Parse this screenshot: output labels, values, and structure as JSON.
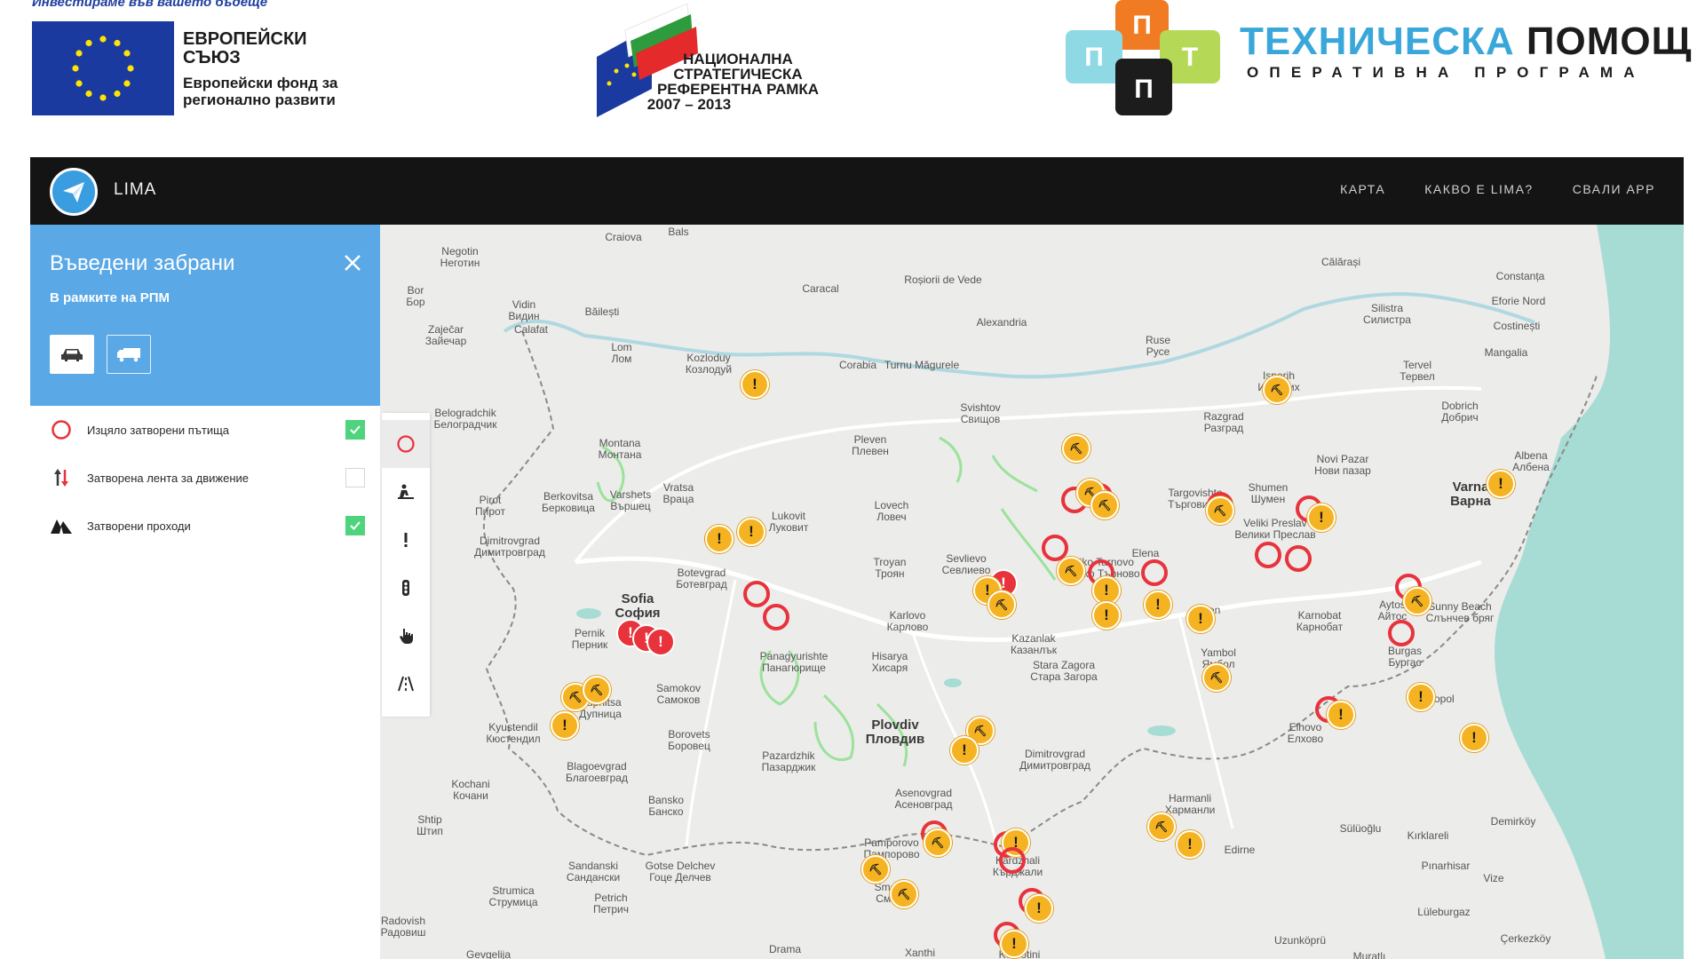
{
  "banner": {
    "eu_tagline": "Инвестираме във вашето бъдеще",
    "eu_title": "ЕВРОПЕЙСКИ СЪЮЗ",
    "eu_fund": "Европейски фонд за регионално развити",
    "nsrf_text": "НАЦИОНАЛНА СТРАТЕГИЧЕСКА РЕФЕРЕНТНА РАМКА",
    "nsrf_years": "2007 – 2013",
    "ta_title_blue": "ТЕХНИЧЕСКА",
    "ta_title_dark": "ПОМОЩ",
    "ta_subtitle": "ОПЕРАТИВНА ПРОГРАМА",
    "ta_letters": [
      "П",
      "П",
      "Т",
      "П"
    ],
    "colors": {
      "eu_blue": "#1a3aa0",
      "ta_blue": "#3aa7da"
    }
  },
  "navbar": {
    "app_name": "LIMA",
    "logo_icon": "paper-plane-icon",
    "links": [
      "КАРТА",
      "КАКВО Е LIMA?",
      "СВАЛИ APP"
    ]
  },
  "panel": {
    "title": "Въведени забрани",
    "subtitle": "В рамките на РПМ",
    "close_icon": "close-icon",
    "vehicle_types": [
      {
        "icon": "car-icon",
        "active": true
      },
      {
        "icon": "truck-icon",
        "active": false
      }
    ],
    "filters": [
      {
        "label": "Изцяло затворени пътища",
        "icon": "closed-road-icon",
        "checked": true
      },
      {
        "label": "Затворена лента за движение",
        "icon": "closed-lane-icon",
        "checked": false
      },
      {
        "label": "Затворени проходи",
        "icon": "mountain-pass-icon",
        "checked": true
      }
    ],
    "accent_color": "#5aa8e6",
    "check_color": "#4fd37d"
  },
  "toolbar": {
    "tools": [
      {
        "icon": "closed-road-icon",
        "active": true
      },
      {
        "icon": "road-works-icon",
        "active": false
      },
      {
        "icon": "warning-icon",
        "active": false
      },
      {
        "icon": "traffic-light-icon",
        "active": false
      },
      {
        "icon": "hand-pointer-icon",
        "active": false
      },
      {
        "icon": "road-icon",
        "active": false
      }
    ]
  },
  "map": {
    "cities_major": [
      {
        "name": "Sofia",
        "local": "София"
      },
      {
        "name": "Plovdiv",
        "local": "Пловдив"
      }
    ],
    "cities": [
      {
        "name": "Craiova",
        "local": ""
      },
      {
        "name": "Bals",
        "local": ""
      },
      {
        "name": "Negotin",
        "local": "Неготин"
      },
      {
        "name": "Bor",
        "local": "Бор"
      },
      {
        "name": "Vidin",
        "local": "Видин"
      },
      {
        "name": "Calafat",
        "local": ""
      },
      {
        "name": "Băilești",
        "local": ""
      },
      {
        "name": "Caracal",
        "local": ""
      },
      {
        "name": "Roșiorii de Vede",
        "local": ""
      },
      {
        "name": "Alexandria",
        "local": ""
      },
      {
        "name": "Călărași",
        "local": ""
      },
      {
        "name": "Constanța",
        "local": ""
      },
      {
        "name": "Eforie Nord",
        "local": ""
      },
      {
        "name": "Costinești",
        "local": ""
      },
      {
        "name": "Mangalia",
        "local": ""
      },
      {
        "name": "Zaječar",
        "local": "Зайечар"
      },
      {
        "name": "Lom",
        "local": "Лом"
      },
      {
        "name": "Kozloduy",
        "local": "Козлодуй"
      },
      {
        "name": "Corabia",
        "local": ""
      },
      {
        "name": "Turnu Măgurele",
        "local": ""
      },
      {
        "name": "Ruse",
        "local": "Русе"
      },
      {
        "name": "Silistra",
        "local": "Силистра"
      },
      {
        "name": "Tervel",
        "local": "Тервел"
      },
      {
        "name": "Dobrich",
        "local": "Добрич"
      },
      {
        "name": "Belogradchik",
        "local": "Белоградчик"
      },
      {
        "name": "Montana",
        "local": "Монтана"
      },
      {
        "name": "Pleven",
        "local": "Плевен"
      },
      {
        "name": "Svishtov",
        "local": "Свищов"
      },
      {
        "name": "Razgrad",
        "local": "Разград"
      },
      {
        "name": "Novi Pazar",
        "local": "Нови пазар"
      },
      {
        "name": "Varna",
        "local": "Варна"
      },
      {
        "name": "Pirot",
        "local": "Пирот"
      },
      {
        "name": "Berkovitsa",
        "local": "Берковица"
      },
      {
        "name": "Varshets",
        "local": "Вършец"
      },
      {
        "name": "Vratsa",
        "local": "Враца"
      },
      {
        "name": "Lukovit",
        "local": "Луковит"
      },
      {
        "name": "Lovech",
        "local": "Ловеч"
      },
      {
        "name": "Targovishte",
        "local": "Търговище"
      },
      {
        "name": "Shumen",
        "local": "Шумен"
      },
      {
        "name": "Veliki Preslav",
        "local": "Велики Преслав"
      },
      {
        "name": "Dimitrovgrad",
        "local": "Димитровград"
      },
      {
        "name": "Botevgrad",
        "local": "Ботевград"
      },
      {
        "name": "Troyan",
        "local": "Троян"
      },
      {
        "name": "Sevlievo",
        "local": "Севлиево"
      },
      {
        "name": "Veliko Tarnovo",
        "local": "Велико Търново"
      },
      {
        "name": "Elena",
        "local": ""
      },
      {
        "name": "Aytos",
        "local": "Айтос"
      },
      {
        "name": "Sunny Beach",
        "local": "Слънчев бряг"
      },
      {
        "name": "Karnobat",
        "local": "Карнобат"
      },
      {
        "name": "Pernik",
        "local": "Перник"
      },
      {
        "name": "Karlovo",
        "local": "Карлово"
      },
      {
        "name": "Kazanlak",
        "local": "Казанлък"
      },
      {
        "name": "Sliven",
        "local": ""
      },
      {
        "name": "Yambol",
        "local": "Ямбол"
      },
      {
        "name": "Burgas",
        "local": "Бургас"
      },
      {
        "name": "Panagyurishte",
        "local": "Панагюрище"
      },
      {
        "name": "Hisarya",
        "local": "Хисаря"
      },
      {
        "name": "Stara Zagora",
        "local": "Стара Загора"
      },
      {
        "name": "Samokov",
        "local": "Самоков"
      },
      {
        "name": "Borovets",
        "local": "Боровец"
      },
      {
        "name": "Dupnitsa",
        "local": "Дупница"
      },
      {
        "name": "Kyustendil",
        "local": "Кюстендил"
      },
      {
        "name": "Sozopol",
        "local": "Созопол"
      },
      {
        "name": "Elhovo",
        "local": "Елхово"
      },
      {
        "name": "Pazardzhik",
        "local": "Пазарджик"
      },
      {
        "name": "Dimitrovgrad",
        "local": "Димитровград"
      },
      {
        "name": "Blagoevgrad",
        "local": "Благоевград"
      },
      {
        "name": "Kochani",
        "local": "Кочани"
      },
      {
        "name": "Asenovgrad",
        "local": "Асеновград"
      },
      {
        "name": "Harmanli",
        "local": "Харманли"
      },
      {
        "name": "Bansko",
        "local": "Банско"
      },
      {
        "name": "Shtip",
        "local": "Штип"
      },
      {
        "name": "Pamporovo",
        "local": "Пампорово"
      },
      {
        "name": "Smolyan",
        "local": "Смолян"
      },
      {
        "name": "Kardzhali",
        "local": "Кърджали"
      },
      {
        "name": "Edirne",
        "local": ""
      },
      {
        "name": "Sülüoğlu",
        "local": ""
      },
      {
        "name": "Kırklareli",
        "local": ""
      },
      {
        "name": "Demirköy",
        "local": ""
      },
      {
        "name": "Sandanski",
        "local": "Сандански"
      },
      {
        "name": "Gotse Delchev",
        "local": "Гоце Делчев"
      },
      {
        "name": "Pınarhisar",
        "local": ""
      },
      {
        "name": "Vize",
        "local": ""
      },
      {
        "name": "Strumica",
        "local": "Струмица"
      },
      {
        "name": "Petrich",
        "local": "Петрич"
      },
      {
        "name": "Lüleburgaz",
        "local": ""
      },
      {
        "name": "Radovish",
        "local": "Радовиш"
      },
      {
        "name": "Uzunköprü",
        "local": ""
      },
      {
        "name": "Çerkezköy",
        "local": ""
      },
      {
        "name": "Gevgelija",
        "local": ""
      },
      {
        "name": "Drama",
        "local": ""
      },
      {
        "name": "Xanthi",
        "local": ""
      },
      {
        "name": "Komotini",
        "local": ""
      },
      {
        "name": "Muratlı",
        "local": ""
      },
      {
        "name": "Albena",
        "local": "Албена"
      },
      {
        "name": "Isperih",
        "local": "Исперих"
      }
    ],
    "marker_colors": {
      "warning": "#f6b321",
      "closed": "#e8323c",
      "sea": "#a7dcd4",
      "border": "#8a8a8a"
    }
  }
}
